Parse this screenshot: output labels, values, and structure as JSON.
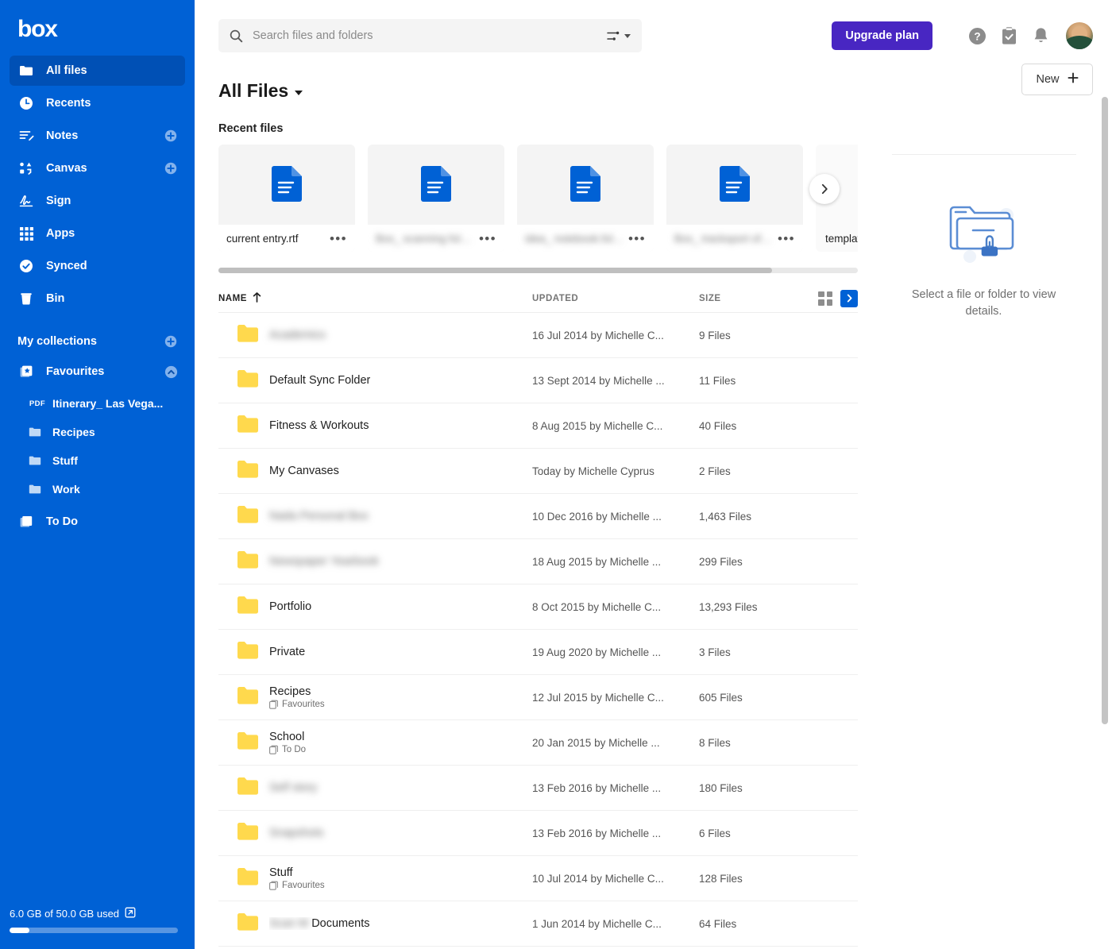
{
  "brand": {
    "logo": "box",
    "primary": "#0061d5",
    "active": "#0050b5",
    "upgrade": "#4826c2"
  },
  "sidebar": {
    "nav": [
      {
        "label": "All files",
        "icon": "folder-icon",
        "active": true,
        "plus": false
      },
      {
        "label": "Recents",
        "icon": "clock-icon",
        "active": false,
        "plus": false
      },
      {
        "label": "Notes",
        "icon": "notes-icon",
        "active": false,
        "plus": true
      },
      {
        "label": "Canvas",
        "icon": "canvas-icon",
        "active": false,
        "plus": true
      },
      {
        "label": "Sign",
        "icon": "signature-icon",
        "active": false,
        "plus": false
      },
      {
        "label": "Apps",
        "icon": "apps-grid-icon",
        "active": false,
        "plus": false
      },
      {
        "label": "Synced",
        "icon": "check-circle-icon",
        "active": false,
        "plus": false
      },
      {
        "label": "Bin",
        "icon": "trash-icon",
        "active": false,
        "plus": false
      }
    ],
    "collections_header": "My collections",
    "favourites": {
      "label": "Favourites",
      "icon": "star-collection-icon"
    },
    "favourite_items": [
      {
        "label": "Itinerary_ Las Vega...",
        "icon": "pdf-icon",
        "tag": "PDF"
      },
      {
        "label": "Recipes",
        "icon": "folder-icon",
        "tag": ""
      },
      {
        "label": "Stuff",
        "icon": "folder-icon",
        "tag": ""
      },
      {
        "label": "Work",
        "icon": "folder-icon",
        "tag": ""
      }
    ],
    "todo": {
      "label": "To Do",
      "icon": "collection-icon"
    },
    "storage": {
      "text": "6.0 GB of 50.0 GB used",
      "percent": 12
    }
  },
  "topbar": {
    "search_placeholder": "Search files and folders",
    "search_value": "",
    "upgrade_label": "Upgrade plan",
    "icons": [
      "help-circle-icon",
      "tasks-clipboard-icon",
      "bell-icon",
      "avatar"
    ]
  },
  "page": {
    "title": "All Files",
    "new_label": "New",
    "recent_label": "Recent files"
  },
  "recent_files": [
    {
      "name": "current entry.rtf",
      "blurred": false,
      "icon": "document-blue-icon"
    },
    {
      "name": "Box_ scanning folder..",
      "blurred": true,
      "icon": "document-blue-icon"
    },
    {
      "name": "idea_ notebook.folder",
      "blurred": true,
      "icon": "document-blue-icon"
    },
    {
      "name": "Box_ tracksport of links",
      "blurred": true,
      "icon": "document-blue-icon"
    },
    {
      "name": "template",
      "blurred": false,
      "icon": "document-blue-icon"
    }
  ],
  "table": {
    "columns": {
      "name": "NAME",
      "updated": "UPDATED",
      "size": "SIZE"
    },
    "sort": "asc",
    "rows": [
      {
        "name": "Academics",
        "blurred": true,
        "blur_prefix": "",
        "updated": "16 Jul 2014 by Michelle C...",
        "size": "9 Files",
        "synced": false,
        "collection": ""
      },
      {
        "name": "Default Sync Folder",
        "blurred": false,
        "blur_prefix": "",
        "updated": "13 Sept 2014 by Michelle ...",
        "size": "11 Files",
        "synced": true,
        "collection": ""
      },
      {
        "name": "Fitness & Workouts",
        "blurred": false,
        "blur_prefix": "",
        "updated": "8 Aug 2015 by Michelle C...",
        "size": "40 Files",
        "synced": false,
        "collection": ""
      },
      {
        "name": "My Canvases",
        "blurred": false,
        "blur_prefix": "",
        "updated": "Today by Michelle Cyprus",
        "size": "2 Files",
        "synced": false,
        "collection": ""
      },
      {
        "name": "Nada Personal Box",
        "blurred": true,
        "blur_prefix": "",
        "updated": "10 Dec 2016 by Michelle ...",
        "size": "1,463 Files",
        "synced": false,
        "collection": ""
      },
      {
        "name": "Newspaper Yearbook",
        "blurred": true,
        "blur_prefix": "",
        "updated": "18 Aug 2015 by Michelle ...",
        "size": "299 Files",
        "synced": false,
        "collection": ""
      },
      {
        "name": "Portfolio",
        "blurred": false,
        "blur_prefix": "",
        "updated": "8 Oct 2015 by Michelle C...",
        "size": "13,293 Files",
        "synced": false,
        "collection": ""
      },
      {
        "name": "Private",
        "blurred": false,
        "blur_prefix": "",
        "updated": "19 Aug 2020 by Michelle ...",
        "size": "3 Files",
        "synced": true,
        "collection": ""
      },
      {
        "name": "Recipes",
        "blurred": false,
        "blur_prefix": "",
        "updated": "12 Jul 2015 by Michelle C...",
        "size": "605 Files",
        "synced": false,
        "collection": "Favourites"
      },
      {
        "name": "School",
        "blurred": false,
        "blur_prefix": "",
        "updated": "20 Jan 2015 by Michelle ...",
        "size": "8 Files",
        "synced": false,
        "collection": "To Do"
      },
      {
        "name": "Self story",
        "blurred": true,
        "blur_prefix": "",
        "updated": "13 Feb 2016 by Michelle ...",
        "size": "180 Files",
        "synced": false,
        "collection": ""
      },
      {
        "name": "Snapshots",
        "blurred": true,
        "blur_prefix": "",
        "updated": "13 Feb 2016 by Michelle ...",
        "size": "6 Files",
        "synced": false,
        "collection": ""
      },
      {
        "name": "Stuff",
        "blurred": false,
        "blur_prefix": "",
        "updated": "10 Jul 2014 by Michelle C...",
        "size": "128 Files",
        "synced": false,
        "collection": "Favourites"
      },
      {
        "name": "Documents",
        "blurred": false,
        "blur_prefix": "Scan M",
        "updated": "1 Jun 2014 by Michelle C...",
        "size": "64 Files",
        "synced": false,
        "collection": ""
      }
    ]
  },
  "detail_panel": {
    "message": "Select a file or folder to view details."
  }
}
